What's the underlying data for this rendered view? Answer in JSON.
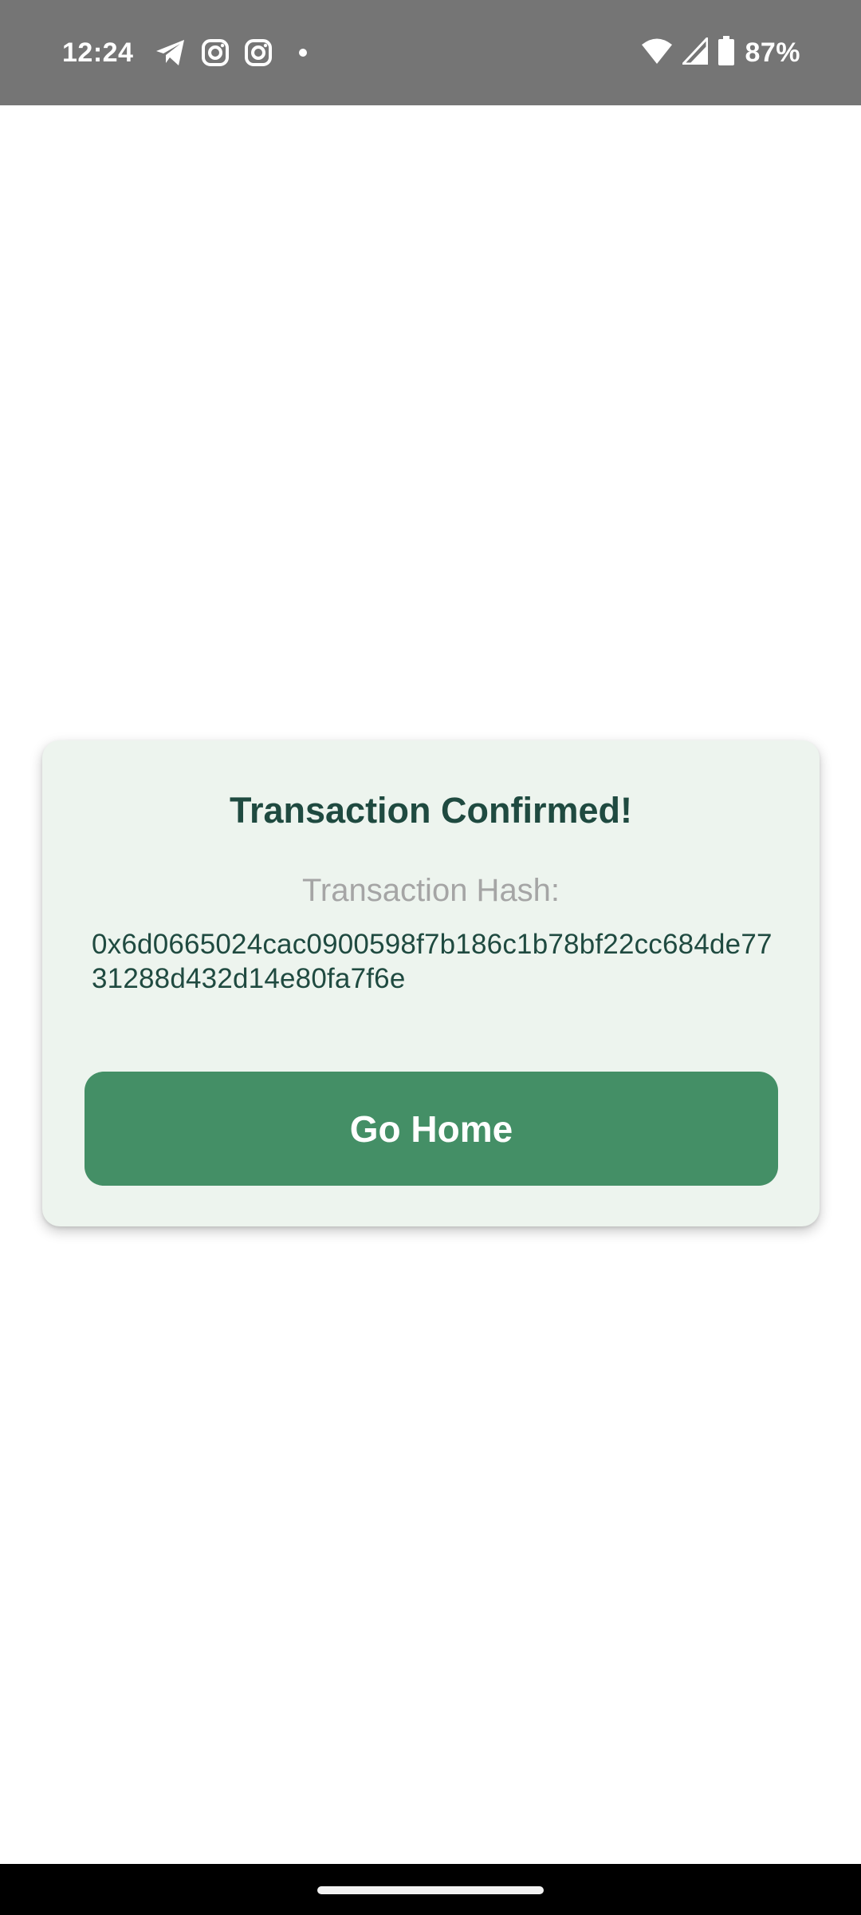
{
  "status_bar": {
    "time": "12:24",
    "battery_percent": "87%",
    "left_icons": [
      "telegram-icon",
      "instagram-icon",
      "instagram-icon",
      "notification-dot-icon"
    ],
    "right_icons": [
      "wifi-icon",
      "cellular-signal-icon",
      "battery-icon"
    ],
    "background_color": "#757575"
  },
  "dialog": {
    "title": "Transaction Confirmed!",
    "hash_label": "Transaction Hash:",
    "hash_value": "0x6d0665024cac0900598f7b186c1b78bf22cc684de7731288d432d14e80fa7f6e",
    "button_label": "Go Home",
    "card_color": "#edf4ee",
    "title_color": "#1f4a40",
    "button_color": "#448f66"
  },
  "nav_bar": {
    "indicator": "home-indicator"
  }
}
